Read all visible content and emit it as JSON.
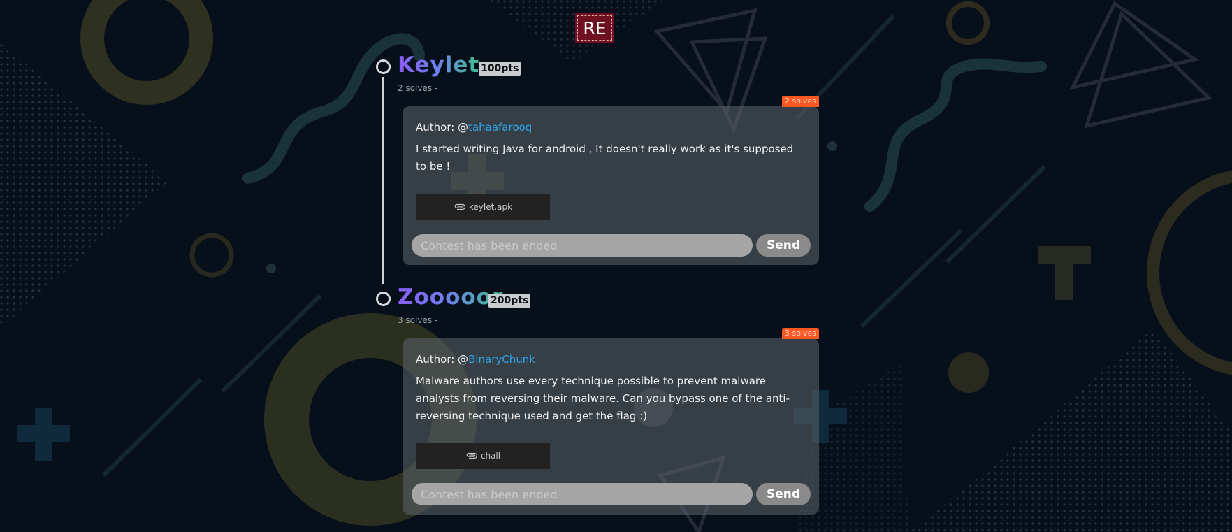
{
  "category": {
    "label": "RE"
  },
  "challenges": [
    {
      "title": "Keylet",
      "points": "100pts",
      "solves_line": "2 solves -",
      "ribbon": "2 solves",
      "author_prefix": "Author: @",
      "author_handle": "tahaafarooq",
      "description": "I started writing Java for android , It doesn't really work as it's supposed to be !",
      "file_name": "keylet.apk",
      "flag_placeholder": "Contest has been ended",
      "send_label": "Send"
    },
    {
      "title": "Zooooor",
      "points": "200pts",
      "solves_line": "3 solves -",
      "ribbon": "3 solves",
      "author_prefix": "Author: @",
      "author_handle": "BinaryChunk",
      "description": "Malware authors use every technique possible to prevent malware analysts from reversing their malware. Can you bypass one of the anti-reversing technique used and get the flag :)",
      "file_name": "chall",
      "flag_placeholder": "Contest has been ended",
      "send_label": "Send"
    }
  ],
  "icons": {
    "file": "paperclip-icon",
    "timeline": "circle-icon"
  },
  "colors": {
    "accent_link": "#2fa4e7",
    "ribbon": "#ff5722",
    "badge": "#6e1020",
    "background": "#07101a"
  }
}
